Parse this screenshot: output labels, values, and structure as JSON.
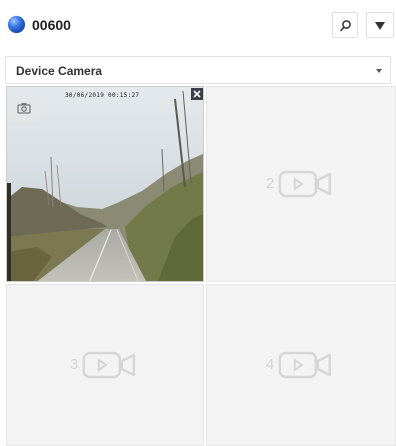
{
  "header": {
    "device_id": "00600",
    "status_color": "#2a63d4"
  },
  "camera_select": {
    "selected": "Device Camera"
  },
  "tiles": [
    {
      "index": "1",
      "state": "live",
      "timestamp": "30/06/2019 00:15:27"
    },
    {
      "index": "2",
      "state": "empty"
    },
    {
      "index": "3",
      "state": "empty"
    },
    {
      "index": "4",
      "state": "empty"
    }
  ],
  "icons": {
    "search": "search-icon",
    "menu": "triangle-down-icon",
    "caret": "caret-down-icon",
    "snapshot": "camera-icon",
    "close": "close-icon",
    "placeholder": "video-camera-icon"
  }
}
